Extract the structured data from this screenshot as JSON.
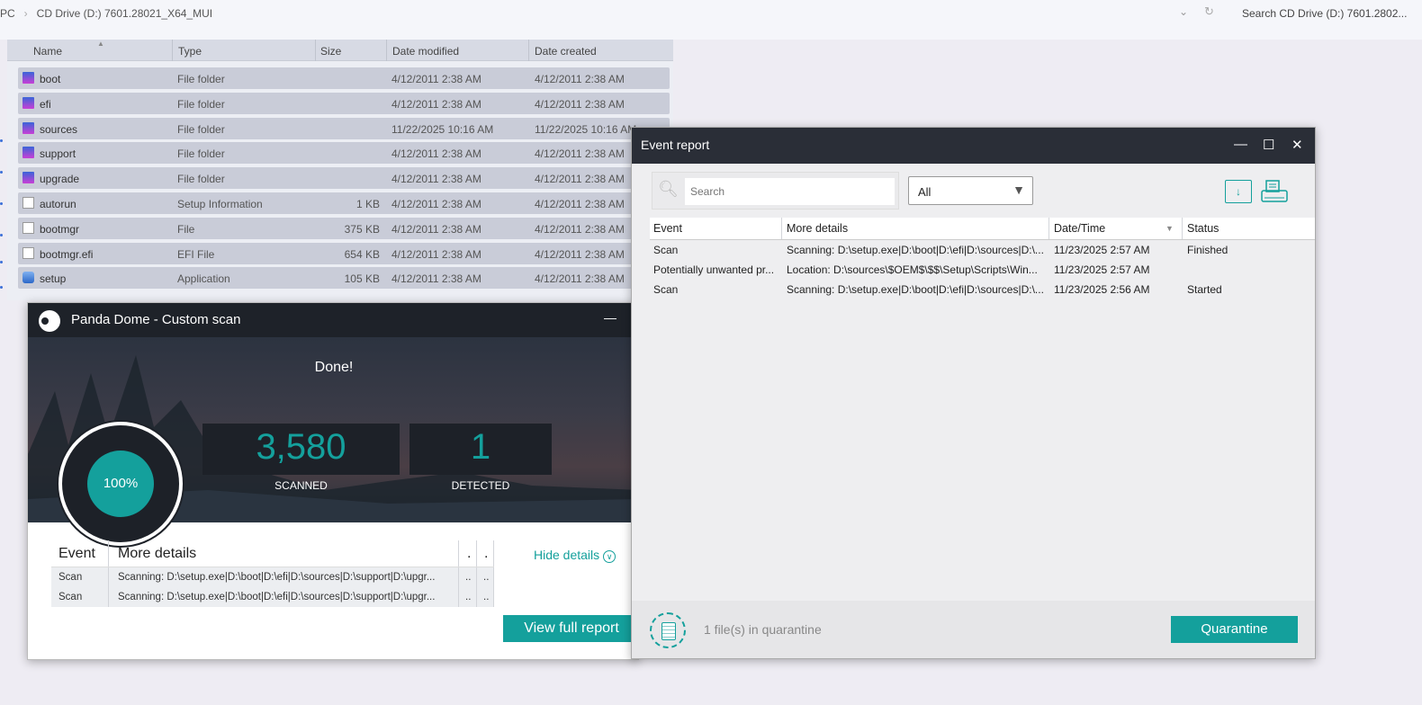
{
  "explorer": {
    "breadcrumb": [
      "PC",
      "›",
      "CD Drive (D:) 7601.28021_X64_MUI"
    ],
    "search_placeholder": "Search CD Drive (D:) 7601.2802...",
    "columns": [
      "Name",
      "Type",
      "Size",
      "Date modified",
      "Date created"
    ],
    "files": [
      {
        "name": "boot",
        "type": "File folder",
        "size": "",
        "modified": "4/12/2011 2:38 AM",
        "created": "4/12/2011 2:38 AM",
        "icon": "folder"
      },
      {
        "name": "efi",
        "type": "File folder",
        "size": "",
        "modified": "4/12/2011 2:38 AM",
        "created": "4/12/2011 2:38 AM",
        "icon": "folder"
      },
      {
        "name": "sources",
        "type": "File folder",
        "size": "",
        "modified": "11/22/2025 10:16 AM",
        "created": "11/22/2025 10:16 AM",
        "icon": "folder"
      },
      {
        "name": "support",
        "type": "File folder",
        "size": "",
        "modified": "4/12/2011 2:38 AM",
        "created": "4/12/2011 2:38 AM",
        "icon": "folder"
      },
      {
        "name": "upgrade",
        "type": "File folder",
        "size": "",
        "modified": "4/12/2011 2:38 AM",
        "created": "4/12/2011 2:38 AM",
        "icon": "folder"
      },
      {
        "name": "autorun",
        "type": "Setup Information",
        "size": "1 KB",
        "modified": "4/12/2011 2:38 AM",
        "created": "4/12/2011 2:38 AM",
        "icon": "file"
      },
      {
        "name": "bootmgr",
        "type": "File",
        "size": "375 KB",
        "modified": "4/12/2011 2:38 AM",
        "created": "4/12/2011 2:38 AM",
        "icon": "file"
      },
      {
        "name": "bootmgr.efi",
        "type": "EFI File",
        "size": "654 KB",
        "modified": "4/12/2011 2:38 AM",
        "created": "4/12/2011 2:38 AM",
        "icon": "file"
      },
      {
        "name": "setup",
        "type": "Application",
        "size": "105 KB",
        "modified": "4/12/2011 2:38 AM",
        "created": "4/12/2011 2:38 AM",
        "icon": "app"
      }
    ]
  },
  "panda": {
    "title": "Panda Dome - Custom scan",
    "status": "Done!",
    "progress": "100%",
    "scanned_value": "3,580",
    "scanned_label": "SCANNED",
    "detected_value": "1",
    "detected_label": "DETECTED",
    "table_headers": [
      "Event",
      "More details",
      ".",
      "."
    ],
    "rows": [
      {
        "event": "Scan",
        "details": "Scanning: D:\\setup.exe|D:\\boot|D:\\efi|D:\\sources|D:\\support|D:\\upgr...",
        "c3": "..",
        "c4": ".."
      },
      {
        "event": "Scan",
        "details": "Scanning: D:\\setup.exe|D:\\boot|D:\\efi|D:\\sources|D:\\support|D:\\upgr...",
        "c3": "..",
        "c4": ".."
      }
    ],
    "hide_details": "Hide details",
    "view_full_report": "View full report",
    "accent": "#14a09c"
  },
  "report": {
    "title": "Event report",
    "search_placeholder": "Search",
    "filter": "All",
    "columns": [
      "Event",
      "More details",
      "Date/Time",
      "Status"
    ],
    "rows": [
      {
        "event": "Scan",
        "details": "Scanning: D:\\setup.exe|D:\\boot|D:\\efi|D:\\sources|D:\\...",
        "datetime": "11/23/2025 2:57 AM",
        "status": "Finished"
      },
      {
        "event": "Potentially unwanted pr...",
        "details": "Location: D:\\sources\\$OEM$\\$$\\Setup\\Scripts\\Win...",
        "datetime": "11/23/2025 2:57 AM",
        "status": ""
      },
      {
        "event": "Scan",
        "details": "Scanning: D:\\setup.exe|D:\\boot|D:\\efi|D:\\sources|D:\\...",
        "datetime": "11/23/2025 2:56 AM",
        "status": "Started"
      }
    ],
    "quarantine_text": "1 file(s) in quarantine",
    "quarantine_button": "Quarantine"
  }
}
